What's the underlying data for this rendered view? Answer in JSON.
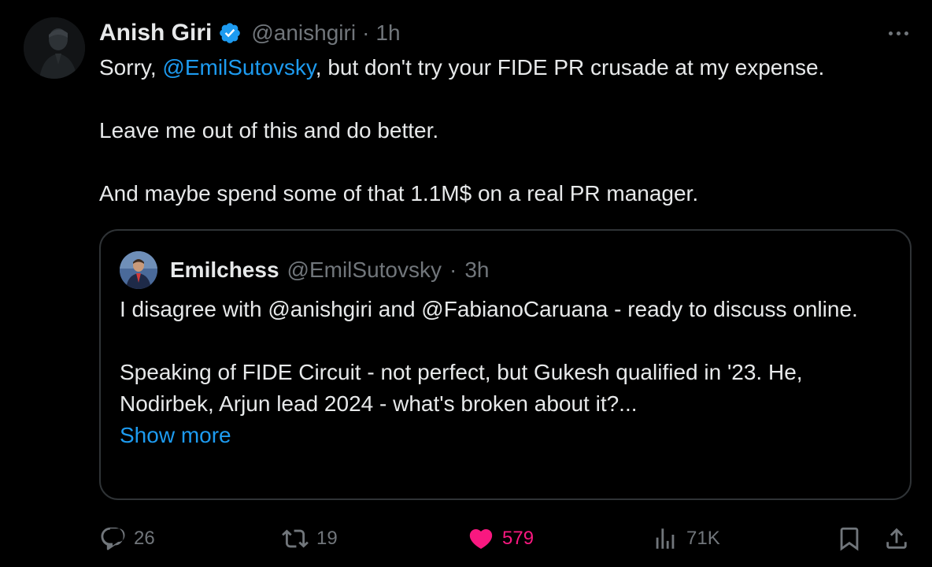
{
  "tweet": {
    "author": {
      "display_name": "Anish Giri",
      "handle": "@anishgiri",
      "separator": "·",
      "time": "1h"
    },
    "text": {
      "line1_prefix": "Sorry, ",
      "line1_mention": "@EmilSutovsky",
      "line1_suffix": ", but don't try your FIDE PR crusade at my expense.",
      "line2": "Leave me out of this and do better.",
      "line3": "And maybe spend some of that 1.1M$ on a real PR manager."
    }
  },
  "quote": {
    "author": {
      "display_name": "Emilchess",
      "handle": "@EmilSutovsky",
      "separator": "·",
      "time": "3h"
    },
    "text": {
      "para1": "I disagree with @anishgiri and @FabianoCaruana - ready to discuss online.",
      "para2": "Speaking of FIDE Circuit - not perfect, but Gukesh qualified in '23. He, Nodirbek, Arjun lead 2024 - what's broken about it?...",
      "show_more": "Show more"
    }
  },
  "actions": {
    "replies": "26",
    "reposts": "19",
    "likes": "579",
    "views": "71K"
  },
  "colors": {
    "background": "#000000",
    "text": "#e7e9ea",
    "muted": "#71767b",
    "link": "#1d9bf0",
    "like": "#f91880",
    "border": "#2f3336"
  },
  "icons": {
    "verified": "verified-badge-icon",
    "more": "more-options-icon",
    "reply": "reply-icon",
    "repost": "repost-icon",
    "like": "heart-icon",
    "views": "views-icon",
    "bookmark": "bookmark-icon",
    "share": "share-icon"
  }
}
